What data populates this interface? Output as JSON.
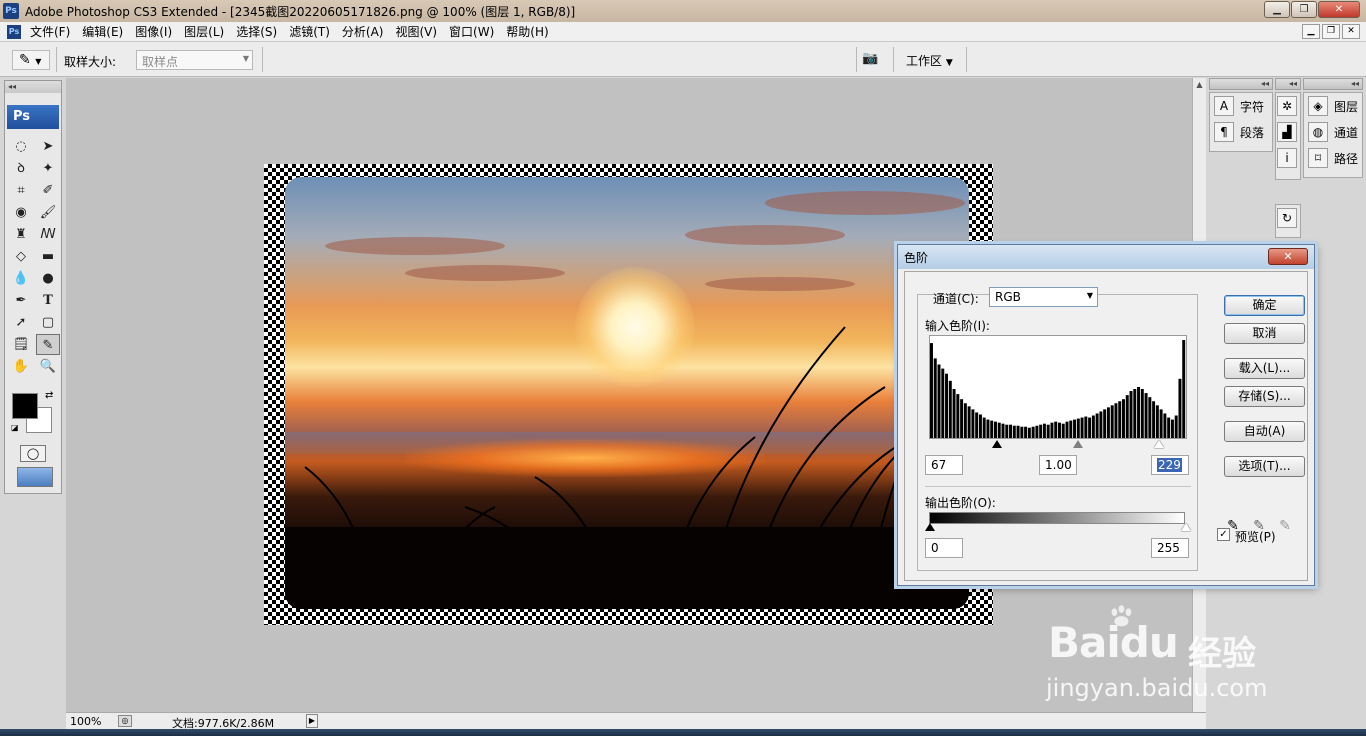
{
  "window": {
    "title": "Adobe Photoshop CS3 Extended - [2345截图20220605171826.png @ 100% (图层 1, RGB/8)]",
    "app_logo": "Ps",
    "buttons": [
      "minimize",
      "maximize",
      "close"
    ]
  },
  "menubar": {
    "items": [
      "文件(F)",
      "编辑(E)",
      "图像(I)",
      "图层(L)",
      "选择(S)",
      "滤镜(T)",
      "分析(A)",
      "视图(V)",
      "窗口(W)",
      "帮助(H)"
    ]
  },
  "options": {
    "sample_size_label": "取样大小:",
    "sample_size_value": "取样点",
    "workspace_label": "工作区"
  },
  "toolbox": {
    "logo": "Ps",
    "tools": [
      "marquee-icon",
      "move-icon",
      "lasso-icon",
      "magic-wand-icon",
      "crop-icon",
      "slice-icon",
      "healing-brush-icon",
      "brush-icon",
      "clone-stamp-icon",
      "history-brush-icon",
      "eraser-icon",
      "gradient-icon",
      "blur-icon",
      "dodge-icon",
      "pen-icon",
      "type-icon",
      "path-selection-icon",
      "shape-icon",
      "notes-icon",
      "eyedropper-icon",
      "hand-icon",
      "zoom-icon"
    ],
    "active_tool": "eyedropper-icon",
    "foreground_color": "#000000",
    "background_color": "#ffffff"
  },
  "statusbar": {
    "zoom": "100%",
    "doc_info": "文档:977.6K/2.86M"
  },
  "right_panels": {
    "col1": [
      {
        "icon": "character-icon",
        "label": "字符"
      },
      {
        "icon": "paragraph-icon",
        "label": "段落"
      }
    ],
    "col2": [
      "navigator-icon",
      "histogram-icon",
      "info-icon"
    ],
    "col3": [
      {
        "icon": "layers-icon",
        "label": "图层"
      },
      {
        "icon": "channels-icon",
        "label": "通道"
      },
      {
        "icon": "paths-icon",
        "label": "路径"
      }
    ]
  },
  "levels_dialog": {
    "title": "色阶",
    "channel_label": "通道(C):",
    "channel_value": "RGB",
    "input_label": "输入色阶(I):",
    "input_black": "67",
    "input_gamma": "1.00",
    "input_white": "229",
    "output_label": "输出色阶(O):",
    "output_black": "0",
    "output_white": "255",
    "buttons": {
      "ok": "确定",
      "cancel": "取消",
      "load": "载入(L)...",
      "save": "存储(S)...",
      "auto": "自动(A)",
      "options": "选项(T)..."
    },
    "preview_label": "预览(P)",
    "preview_checked": true,
    "histogram": {
      "bins": [
        95,
        80,
        74,
        70,
        65,
        58,
        50,
        45,
        40,
        36,
        33,
        30,
        27,
        25,
        22,
        20,
        19,
        18,
        17,
        16,
        15,
        15,
        14,
        14,
        13,
        13,
        12,
        13,
        14,
        15,
        16,
        15,
        17,
        18,
        17,
        16,
        18,
        19,
        20,
        21,
        22,
        23,
        22,
        24,
        26,
        28,
        30,
        32,
        34,
        36,
        38,
        40,
        44,
        48,
        50,
        52,
        50,
        46,
        42,
        38,
        34,
        30,
        26,
        22,
        20,
        24,
        60,
        98
      ]
    }
  },
  "watermark": {
    "brand": "Bai",
    "brand2": "du",
    "cn": "经验",
    "url": "jingyan.baidu.com"
  }
}
